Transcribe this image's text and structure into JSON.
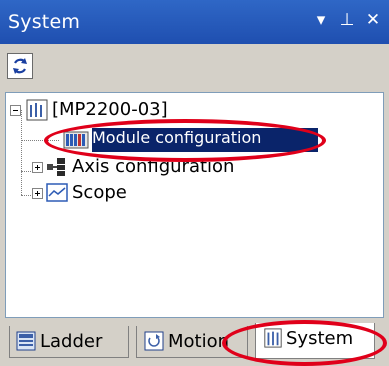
{
  "window": {
    "title": "System",
    "buttons": {
      "dropdown": "▾",
      "pin": "⊥",
      "close": "✕"
    }
  },
  "toolbar": {
    "refresh_icon": "refresh-icon"
  },
  "tree": {
    "root": {
      "label": "[MP2200-03]",
      "icon": "controller-icon",
      "expanded": true
    },
    "children": [
      {
        "label": "Module configuration",
        "icon": "module-config-icon",
        "selected": true
      },
      {
        "label": "Axis configuration",
        "icon": "axis-config-icon",
        "expander": "+"
      },
      {
        "label": "Scope",
        "icon": "scope-icon",
        "expander": "+"
      }
    ]
  },
  "tabs": [
    {
      "label": "Ladder",
      "icon": "ladder-icon",
      "active": false
    },
    {
      "label": "Motion",
      "icon": "motion-icon",
      "active": false
    },
    {
      "label": "System",
      "icon": "system-icon",
      "active": true
    }
  ],
  "colors": {
    "titlebar": "#2f67c6",
    "selection": "#0a246a",
    "annotation": "#e0001a"
  }
}
